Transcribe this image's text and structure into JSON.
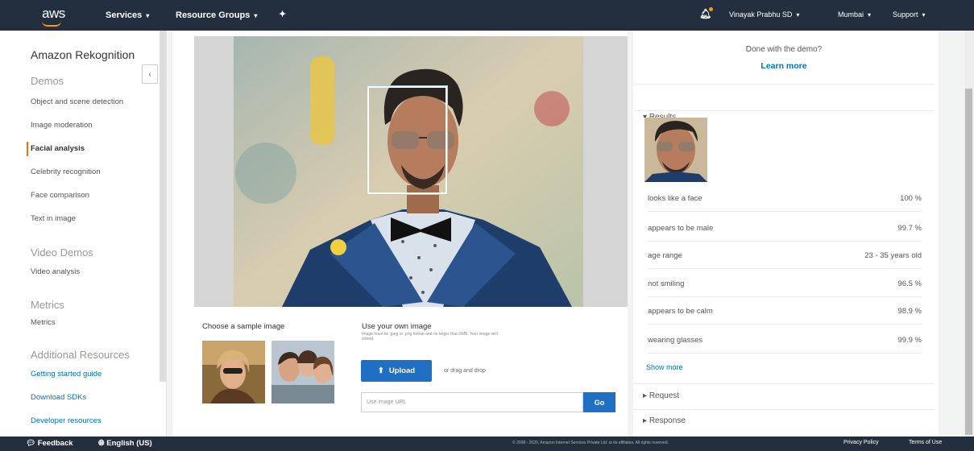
{
  "topnav": {
    "logo": "aws",
    "services": "Services",
    "resource_groups": "Resource Groups",
    "user": "Vinayak Prabhu SD",
    "region": "Mumbai",
    "support": "Support"
  },
  "sidebar": {
    "title": "Amazon Rekognition",
    "sections": {
      "demos": "Demos",
      "video_demos": "Video Demos",
      "metrics": "Metrics",
      "additional": "Additional Resources"
    },
    "demo_items": [
      "Object and scene detection",
      "Image moderation",
      "Facial analysis",
      "Celebrity recognition",
      "Face comparison",
      "Text in image"
    ],
    "video_items": [
      "Video analysis"
    ],
    "metrics_items": [
      "Metrics"
    ],
    "resource_items": [
      "Getting started guide",
      "Download SDKs",
      "Developer resources"
    ]
  },
  "main": {
    "sample_label": "Choose a sample image",
    "own_label": "Use your own image",
    "own_sub": "Image must be .jpeg or .png format and no larger than 5MB. Your image isn't stored.",
    "upload_label": "Upload",
    "drag_text": "or drag and drop",
    "url_placeholder": "Use image URL",
    "go_label": "Go"
  },
  "results": {
    "done_text": "Done with the demo?",
    "learn_more": "Learn more",
    "results_label": "Results",
    "rows": [
      {
        "label": "looks like a face",
        "value": "100 %"
      },
      {
        "label": "appears to be male",
        "value": "99.7 %"
      },
      {
        "label": "age range",
        "value": "23 - 35 years old"
      },
      {
        "label": "not smiling",
        "value": "96.5 %"
      },
      {
        "label": "appears to be calm",
        "value": "98.9 %"
      },
      {
        "label": "wearing glasses",
        "value": "99.9 %"
      }
    ],
    "show_more": "Show more",
    "request_label": "Request",
    "response_label": "Response"
  },
  "footer": {
    "feedback": "Feedback",
    "language": "English (US)",
    "copyright": "© 2008 - 2020, Amazon Internet Services Private Ltd. or its affiliates. All rights reserved.",
    "privacy": "Privacy Policy",
    "terms": "Terms of Use"
  },
  "colors": {
    "nav_bg": "#232f3e",
    "accent": "#ec7211",
    "link": "#0073bb",
    "button": "#1f6fc5"
  }
}
